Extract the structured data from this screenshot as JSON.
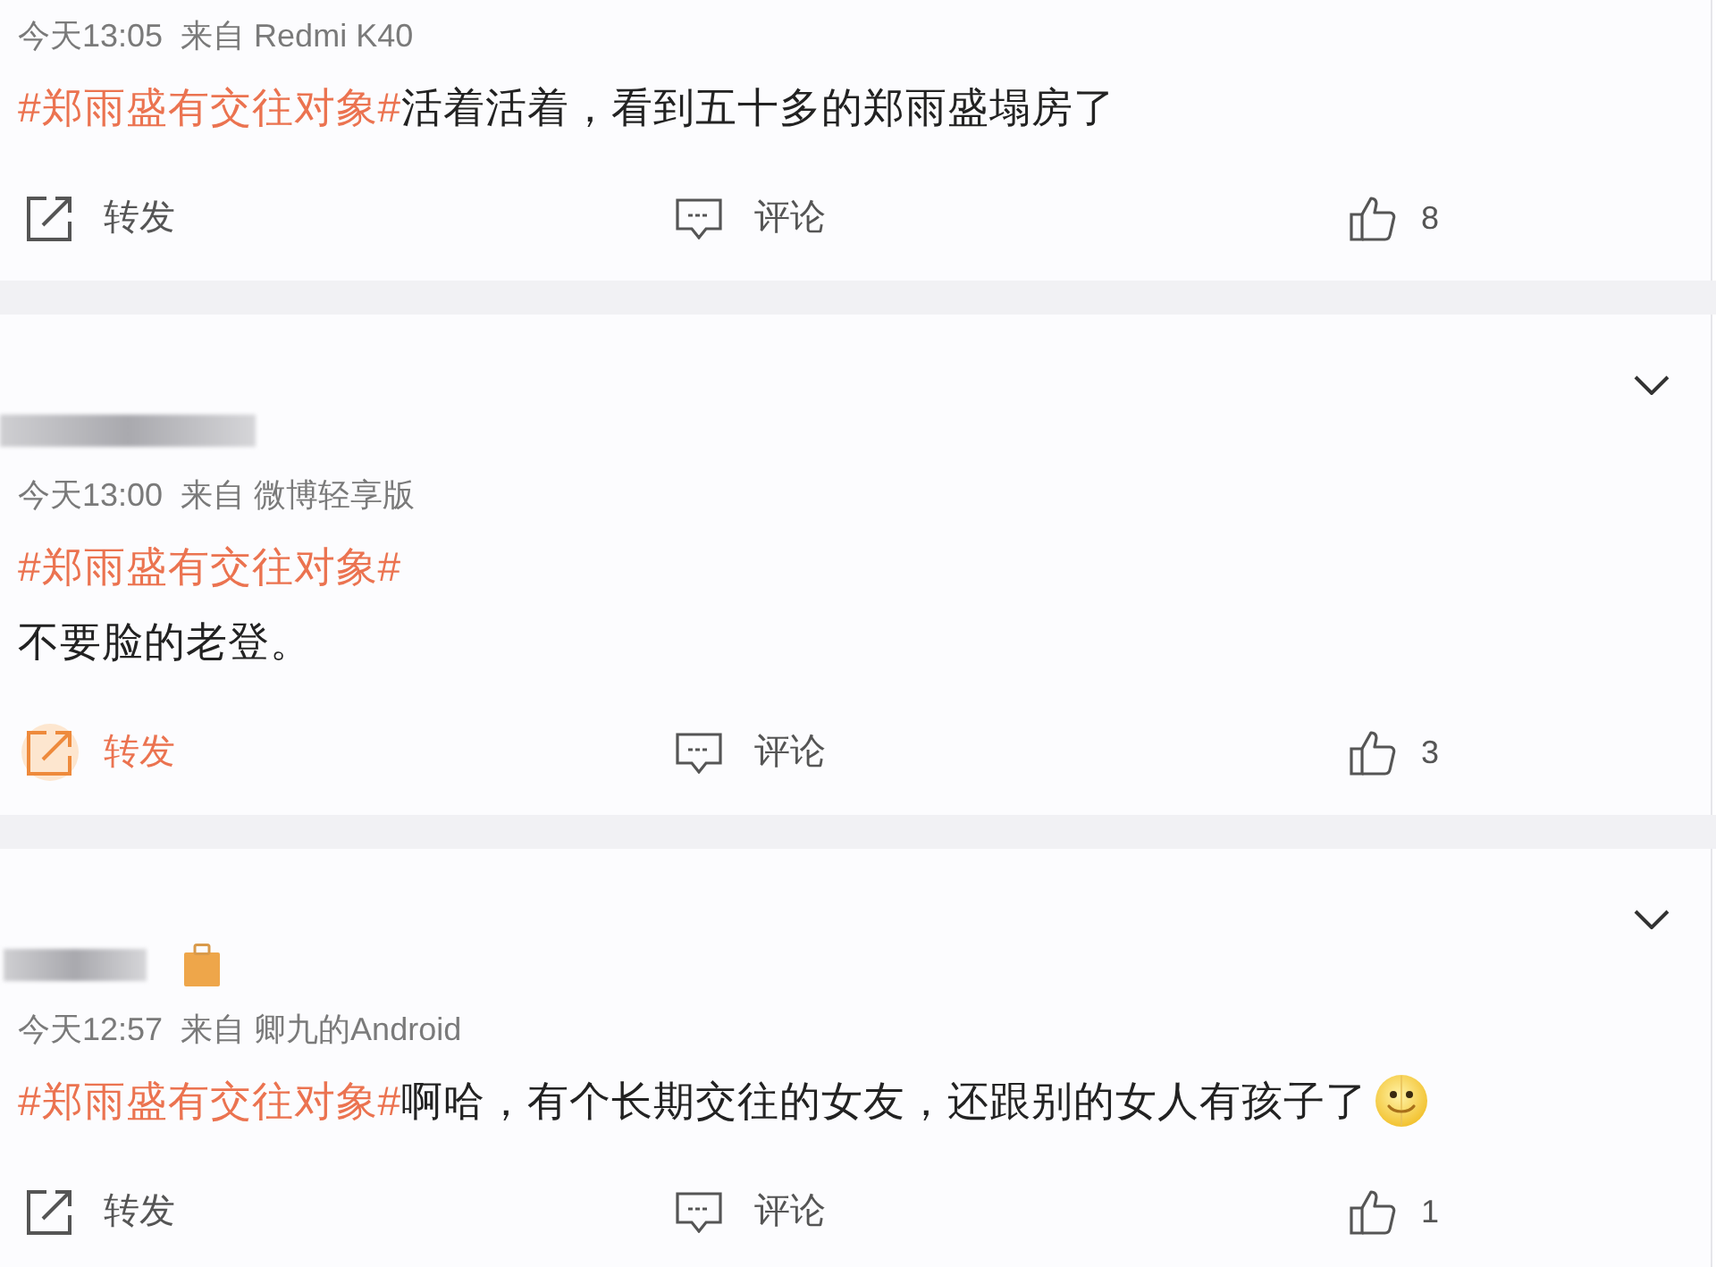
{
  "comments": [
    {
      "menu_button": false,
      "time": "今天13:05",
      "source": "来自 Redmi K40",
      "paragraphs": [
        [
          {
            "kind": "hashtag",
            "text": "#郑雨盛有交往对象#"
          },
          {
            "kind": "text",
            "text": "活着活着，看到五十多的郑雨盛塌房了"
          }
        ]
      ],
      "actions": {
        "repost": {
          "label": "转发",
          "highlighted": false
        },
        "comment": {
          "label": "评论"
        },
        "like": {
          "count": "8"
        }
      }
    },
    {
      "menu_button": true,
      "author": {
        "badge": false
      },
      "time": "今天13:00",
      "source": "来自 微博轻享版",
      "paragraphs": [
        [
          {
            "kind": "hashtag",
            "text": "#郑雨盛有交往对象#"
          }
        ],
        [
          {
            "kind": "text",
            "text": "不要脸的老登。"
          }
        ]
      ],
      "actions": {
        "repost": {
          "label": "转发",
          "highlighted": true
        },
        "comment": {
          "label": "评论"
        },
        "like": {
          "count": "3"
        }
      }
    },
    {
      "menu_button": true,
      "author": {
        "badge": true
      },
      "time": "今天12:57",
      "source": "来自 卿九的Android",
      "paragraphs": [
        [
          {
            "kind": "hashtag",
            "text": "#郑雨盛有交往对象#"
          },
          {
            "kind": "text",
            "text": "啊哈，有个长期交往的女友，还跟别的女人有孩子了"
          },
          {
            "kind": "emoji"
          }
        ]
      ],
      "actions": {
        "repost": {
          "label": "转发",
          "highlighted": false
        },
        "comment": {
          "label": "评论"
        },
        "like": {
          "count": "1"
        }
      }
    }
  ]
}
